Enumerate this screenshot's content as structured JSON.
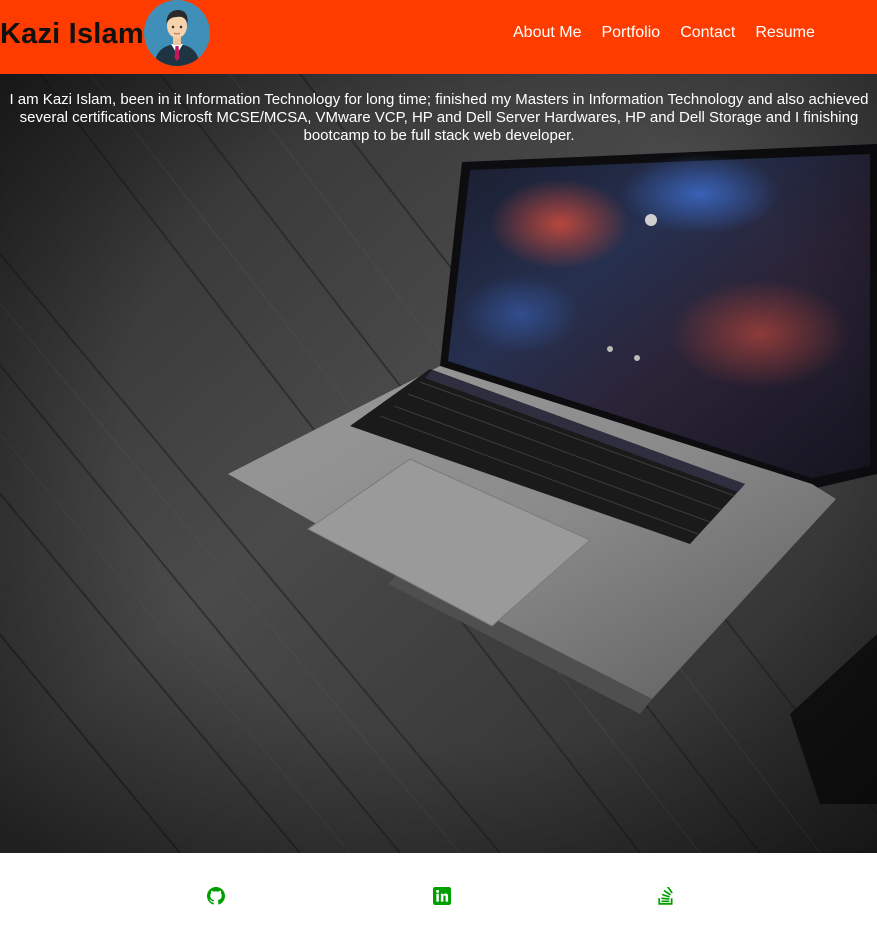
{
  "header": {
    "brand_name": "Kazi Islam",
    "avatar_icon": "person-avatar-icon",
    "background_color": "#ff3c00",
    "nav": [
      {
        "label": "About Me"
      },
      {
        "label": "Portfolio"
      },
      {
        "label": "Contact"
      },
      {
        "label": "Resume"
      }
    ]
  },
  "hero": {
    "intro": "I am Kazi Islam, been in it Information Technology for long time; finished my Masters in Information Technology and also achieved several certifications Microsft MCSE/MCSA, VMware VCP, HP and Dell Server Hardwares, HP and Dell Storage and I finishing bootcamp to be full stack web developer.",
    "background_image": "laptop-on-wooden-desk"
  },
  "footer": {
    "icon_color": "#00a000",
    "social_links": [
      {
        "icon": "github-icon"
      },
      {
        "icon": "linkedin-icon"
      },
      {
        "icon": "stack-overflow-icon"
      }
    ]
  }
}
